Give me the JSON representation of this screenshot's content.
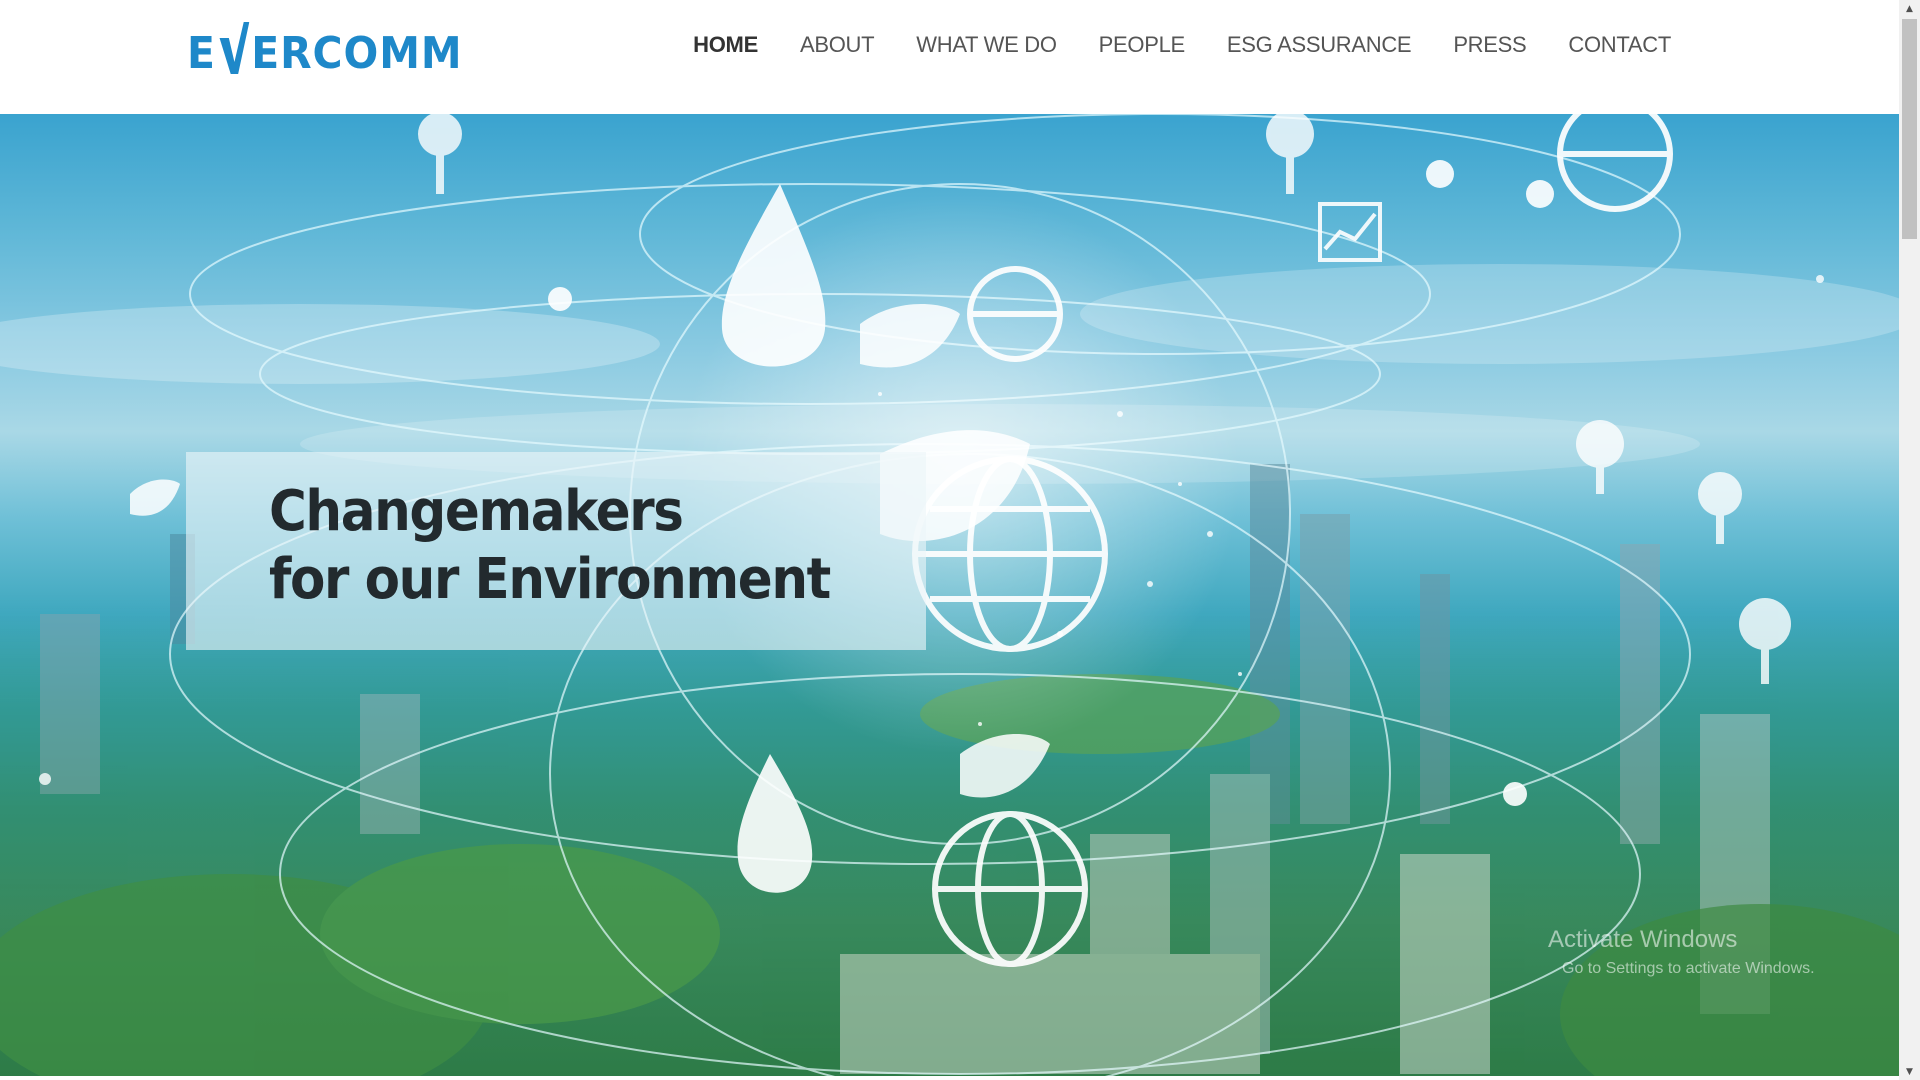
{
  "header": {
    "logo_text": "EVERCOMM",
    "logo_prefix": "E",
    "logo_suffix": "ERCOMM",
    "brand_color": "#1e88c9"
  },
  "nav": {
    "items": [
      {
        "label": "HOME",
        "active": true
      },
      {
        "label": "ABOUT",
        "active": false
      },
      {
        "label": "WHAT WE DO",
        "active": false
      },
      {
        "label": "PEOPLE",
        "active": false
      },
      {
        "label": "ESG ASSURANCE",
        "active": false
      },
      {
        "label": "PRESS",
        "active": false
      },
      {
        "label": "CONTACT",
        "active": false
      }
    ]
  },
  "hero": {
    "title_line1": "Changemakers",
    "title_line2": "for our Environment",
    "background_description_icon": "smart-city-eco-icons"
  },
  "os_watermark": {
    "title": "Activate Windows",
    "subtitle": "Go to Settings to activate Windows."
  },
  "scrollbar": {
    "up_icon": "arrow-up-icon",
    "down_icon": "arrow-down-icon"
  }
}
